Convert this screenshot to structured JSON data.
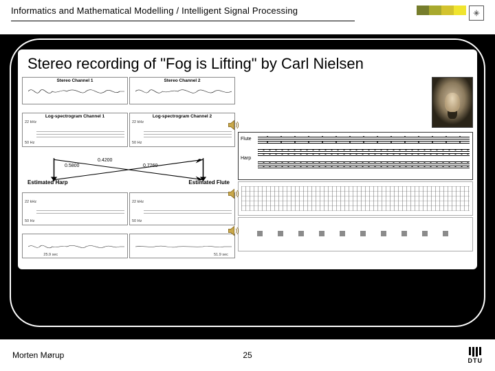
{
  "header": {
    "breadcrumb": "Informatics and Mathematical Modelling / Intelligent Signal Processing"
  },
  "slide": {
    "title": "Stereo recording of \"Fog is Lifting\" by Carl Nielsen"
  },
  "left": {
    "ch1": "Stereo Channel 1",
    "ch2": "Stereo Channel 2",
    "logspec1": "Log-spectrogram Channel 1",
    "logspec2": "Log-spectrogram Channel 2",
    "freq_top": "22 kHz",
    "freq_bot": "50 Hz",
    "t_left_a": "25.9 sec",
    "t_right_a": "51.9 sec",
    "cross": {
      "v1": "0.5800",
      "v2": "0.4200",
      "v3": "0.7260"
    },
    "est_harp": "Estimated Harp",
    "est_flute": "Estimated Flute"
  },
  "score": {
    "inst1": "Flute",
    "inst2": "Harp"
  },
  "icons": {
    "speaker": "speaker-icon"
  },
  "footer": {
    "author": "Morten Mørup",
    "page": "25",
    "org": "DTU"
  }
}
